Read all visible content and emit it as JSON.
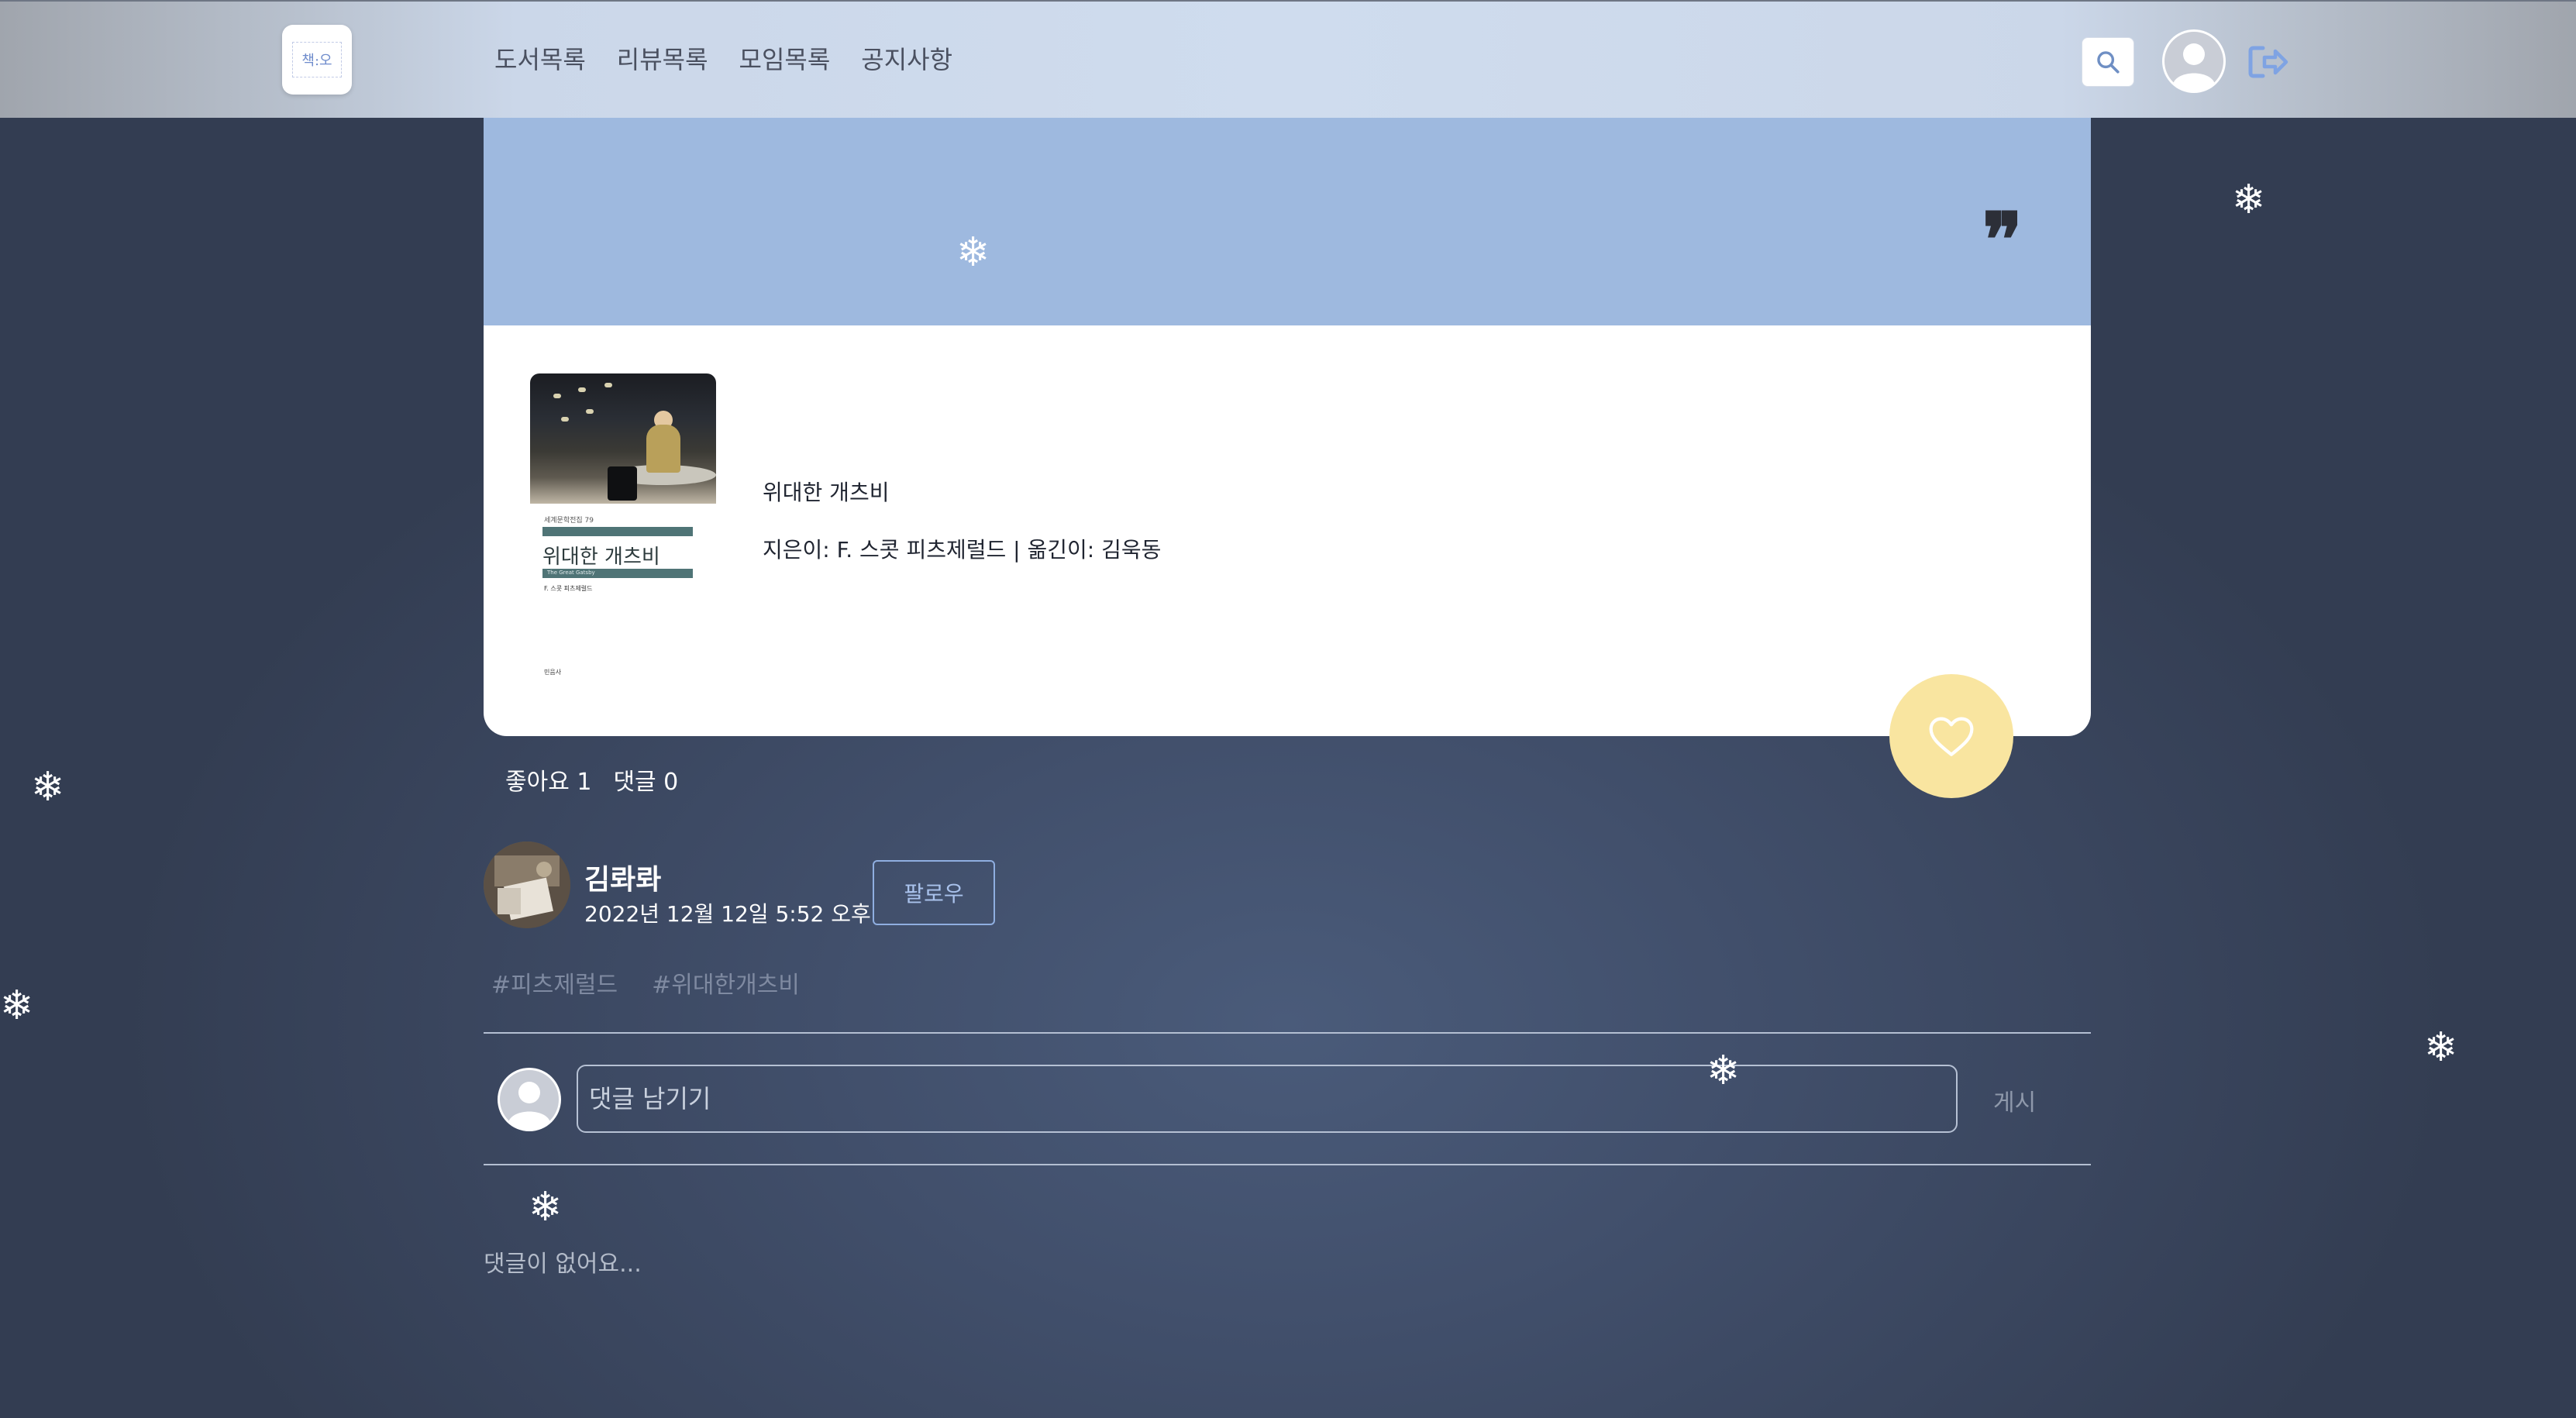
{
  "nav": {
    "logo_text": "책:오",
    "links": [
      "도서목록",
      "리뷰목록",
      "모임목록",
      "공지사항"
    ]
  },
  "quote": {
    "mark": "❞"
  },
  "book": {
    "title": "위대한 개츠비",
    "meta": "지은이: F. 스콧 피츠제럴드 | 옮긴이: 김욱동",
    "cover": {
      "series": "세계문학전집 79",
      "title": "위대한 개츠비",
      "subtitle": "The Great Gatsby",
      "author": "F. 스콧 피츠제럴드",
      "publisher": "민음사"
    }
  },
  "stats": {
    "likes": "좋아요 1",
    "comments": "댓글 0"
  },
  "post": {
    "author": "김롸롸",
    "date": "2022년 12월 12일 5:52 오후",
    "follow_label": "팔로우",
    "tags": [
      "#피츠제럴드",
      "#위대한개츠비"
    ]
  },
  "comment_form": {
    "placeholder": "댓글 남기기",
    "submit_label": "게시"
  },
  "no_comments": "댓글이 없어요...",
  "snowflake": "❄",
  "colors": {
    "quote_panel": "#9eb9df",
    "like_button": "#f9e5a0",
    "accent": "#8faee0"
  }
}
